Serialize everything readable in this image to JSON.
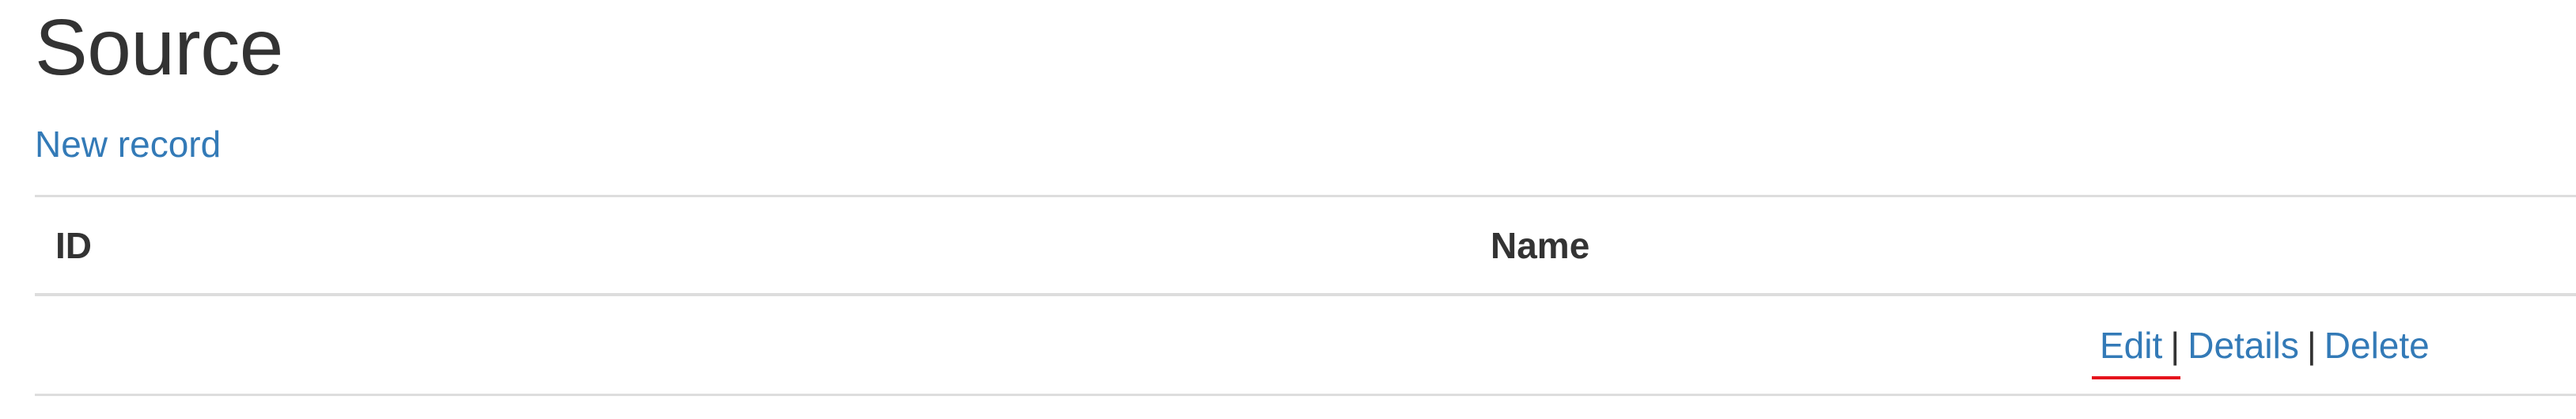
{
  "page": {
    "title": "Source",
    "new_record_label": "New record"
  },
  "table": {
    "columns": [
      "ID",
      "Name"
    ],
    "rows": [
      {
        "id": "",
        "name": "",
        "actions": {
          "edit": "Edit",
          "details": "Details",
          "delete": "Delete",
          "separator": "|"
        }
      }
    ]
  },
  "colors": {
    "link": "#337ab7",
    "text": "#333333",
    "border": "#dddddd",
    "highlight_underline": "#e5131c"
  }
}
